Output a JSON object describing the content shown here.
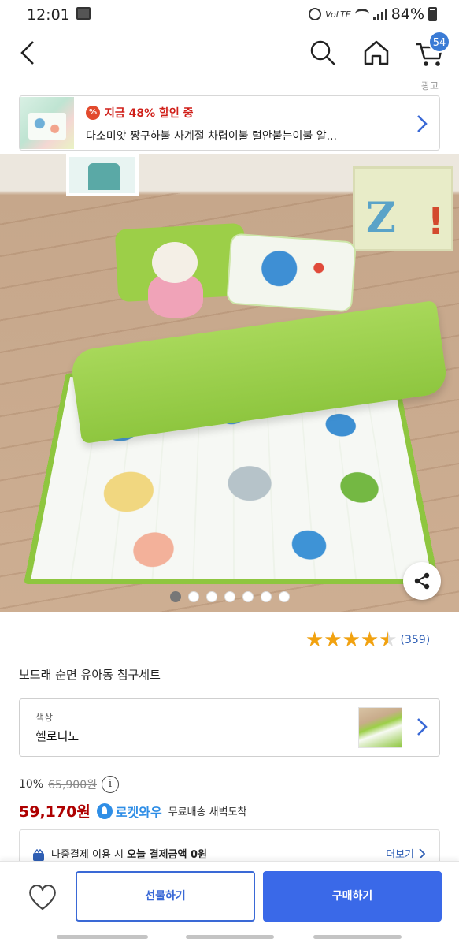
{
  "status_bar": {
    "time": "12:01",
    "network_label": "VoLTE",
    "battery": "84%",
    "battery_level": 0.84,
    "icons": [
      "gallery-icon",
      "alarm-icon",
      "wifi-icon",
      "signal-icon",
      "battery-icon"
    ]
  },
  "header": {
    "cart_count": "54",
    "icons": [
      "back-icon",
      "search-icon",
      "home-icon",
      "cart-icon"
    ]
  },
  "ad": {
    "label": "광고",
    "discount_badge": "%",
    "discount_text": "지금 48% 할인 중",
    "title": "다소미앗 짱구하불 사계절 차렵이불 털안붙는이불 알..."
  },
  "gallery": {
    "image_count": 7,
    "active_index": 0,
    "icons": [
      "share-icon"
    ]
  },
  "rating": {
    "stars": 4.5,
    "max_stars": 5,
    "review_count": "(359)",
    "accent_color": "#f2a20f"
  },
  "product": {
    "title": "보드래 순면 유아동 침구세트"
  },
  "option": {
    "label": "색상",
    "value": "헬로디노"
  },
  "pricing": {
    "discount_rate": "10%",
    "original_price": "65,900원",
    "info_glyph": "i",
    "sale_price": "59,170원",
    "rocket_label": "로켓와우",
    "delivery_text": "무료배송 새벽도착",
    "sale_color": "#ae0000",
    "rocket_color": "#2f8ee6"
  },
  "payment_notice": {
    "text_prefix": "나중결제 이용 시",
    "text_bold": "오늘 결제금액 0원",
    "more_link": "더보기"
  },
  "actions": {
    "gift_label": "선물하기",
    "buy_label": "구매하기",
    "brand_color": "#3a69e8"
  }
}
